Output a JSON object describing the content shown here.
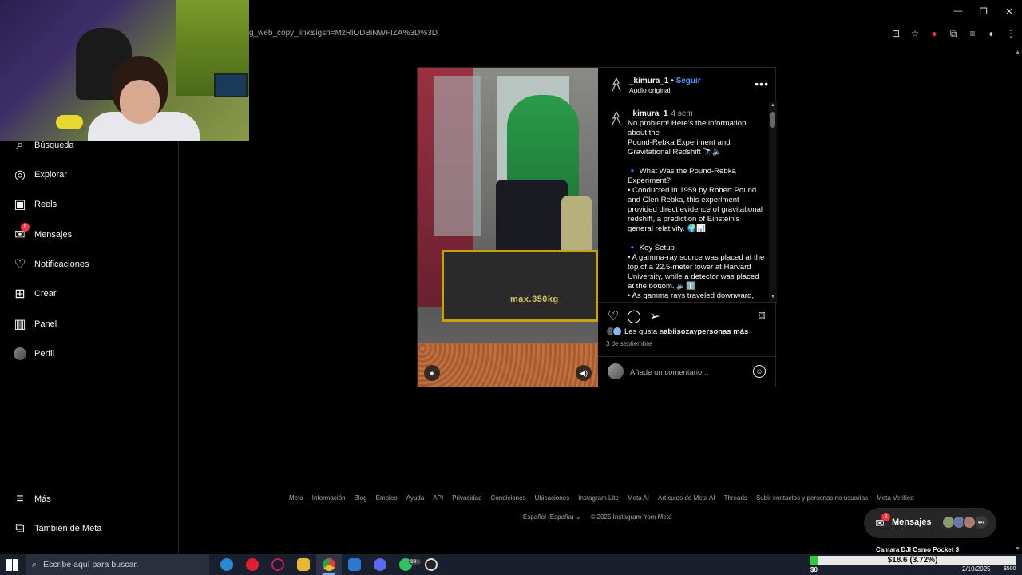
{
  "browser": {
    "url": "g_web_copy_link&igsh=MzRlODBiNWFIZA%3D%3D",
    "window_controls": {
      "minimize": "—",
      "restore": "❐",
      "close": "✕"
    }
  },
  "sidebar": {
    "items": [
      {
        "label": "Búsqueda",
        "icon": "search-icon",
        "glyph": "⌕"
      },
      {
        "label": "Explorar",
        "icon": "compass-icon",
        "glyph": "◎"
      },
      {
        "label": "Reels",
        "icon": "reels-icon",
        "glyph": "▣"
      },
      {
        "label": "Mensajes",
        "icon": "messenger-icon",
        "glyph": "✉",
        "badge": "8"
      },
      {
        "label": "Notificaciones",
        "icon": "heart-icon",
        "glyph": "♡"
      },
      {
        "label": "Crear",
        "icon": "plus-square-icon",
        "glyph": "⊞"
      },
      {
        "label": "Panel",
        "icon": "dashboard-icon",
        "glyph": "▥"
      },
      {
        "label": "Perfil",
        "icon": "avatar-icon",
        "glyph": ""
      }
    ],
    "bottom": [
      {
        "label": "Más",
        "icon": "menu-icon",
        "glyph": "≡"
      },
      {
        "label": "También de Meta",
        "icon": "meta-apps-icon",
        "glyph": "⧉"
      }
    ]
  },
  "post": {
    "header": {
      "username": "_kimura_1",
      "separator": "•",
      "follow": "Seguir",
      "audio": "Audio original",
      "more": "•••"
    },
    "caption": {
      "username": "_kimura_1",
      "time": "4 sem",
      "text": "No problem! Here's the information about the\nPound-Rebka Experiment and Gravitational Redshift 🔭🔈\n\n🔹 What Was the Pound-Rebka Experiment?\n• Conducted in 1959 by Robert Pound and Glen Rebka, this experiment provided direct evidence of gravitational redshift, a prediction of Einstein's general relativity. 🌍📊\n\n🔹 Key Setup\n• A gamma-ray source was placed at the top of a 22.5-meter tower at Harvard University, while a detector was placed at the bottom. 🔈ℹ️\n• As gamma rays traveled downward,"
    },
    "media": {
      "sign_text": "max.350kg"
    },
    "likes": {
      "prefix": "Les gusta a ",
      "user": "abiisoza",
      "middle": " y ",
      "others": "personas más"
    },
    "date": "3 de septiembre",
    "comment_placeholder": "Añade un comentario..."
  },
  "footer": {
    "links": [
      "Meta",
      "Información",
      "Blog",
      "Empleo",
      "Ayuda",
      "API",
      "Privacidad",
      "Condiciones",
      "Ubicaciones",
      "Instagram Lite",
      "Meta AI",
      "Artículos de Meta AI",
      "Threads",
      "Subir contactos y personas no usuarias",
      "Meta Verified"
    ],
    "language": "Español (España)",
    "copyright": "© 2025 Instagram from Meta"
  },
  "messages_pill": {
    "label": "Mensajes",
    "badge": "8"
  },
  "taskbar": {
    "search_placeholder": "Escribe aquí para buscar.",
    "notification_count": "99+",
    "date": "2/10/2025"
  },
  "stream_overlay": {
    "camera_label": "Camara DJI Osmo Pocket 3",
    "goal_text": "$18.6 (3.72%)",
    "goal_progress": 0.0372,
    "goal_min": "$0",
    "goal_max": "$500"
  },
  "colors": {
    "accent": "#4a9aff",
    "badge": "#ff3040",
    "progress": "#2ecc40"
  }
}
